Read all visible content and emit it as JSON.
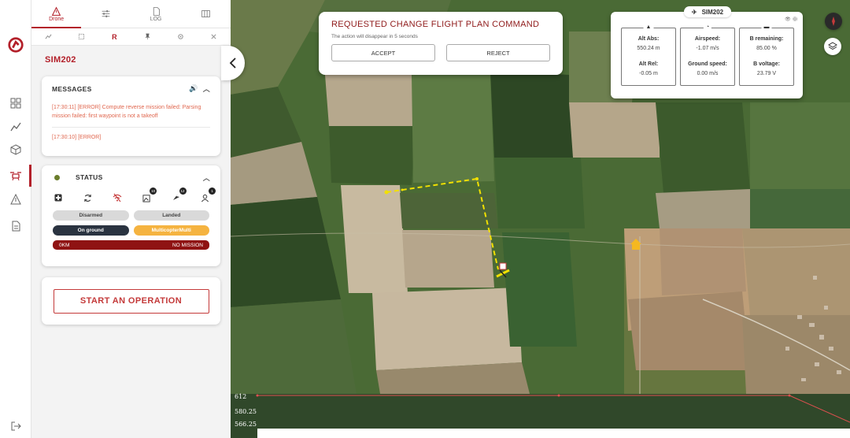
{
  "rail": {
    "items": [
      "dashboard-icon",
      "chart-icon",
      "cube-icon",
      "drone-icon",
      "alert-icon",
      "document-icon"
    ],
    "logout_icon": "logout-icon"
  },
  "tabs": [
    {
      "label": "Drone",
      "icon": "warning-triangle-icon",
      "active": true
    },
    {
      "label": "",
      "icon": "sliders-icon",
      "active": false
    },
    {
      "label": "LOG",
      "icon": "log-icon",
      "active": false
    },
    {
      "label": "",
      "icon": "map-grid-icon",
      "active": false
    }
  ],
  "subtabs": [
    "trend-icon",
    "crop-icon",
    "R",
    "pin-icon",
    "target-icon",
    "close-icon"
  ],
  "drone_name": "SIM202",
  "messages": {
    "title": "MESSAGES",
    "items": [
      "[17:30:11] [ERROR] Compute reverse mission failed: Parsing mission failed: first waypoint is not a takeoff",
      "[17:30:10] [ERROR]"
    ]
  },
  "status": {
    "title": "STATUS",
    "badges": {
      "photos": "10",
      "waypoints": "12",
      "users": "1"
    },
    "pills": [
      "Disarmed",
      "Landed",
      "On ground",
      "MulticopterMulti"
    ],
    "mission_left": "0KM",
    "mission_right": "NO MISSION"
  },
  "operation_button": "START AN OPERATION",
  "command": {
    "title": "REQUESTED CHANGE FLIGHT PLAN COMMAND",
    "subtitle": "The action will disappear in 5 seconds",
    "accept": "ACCEPT",
    "reject": "REJECT"
  },
  "telemetry": {
    "drone": "SIM202",
    "alt_abs_label": "Alt Abs:",
    "alt_abs": "550.24 m",
    "alt_rel_label": "Alt Rel:",
    "alt_rel": "-0.05 m",
    "airspeed_label": "Airspeed:",
    "airspeed": "-1.07 m/s",
    "ground_speed_label": "Ground speed:",
    "ground_speed": "0.00 m/s",
    "b_remaining_label": "B remaining:",
    "b_remaining": "85.00 %",
    "b_voltage_label": "B voltage:",
    "b_voltage": "23.79 V"
  },
  "altitude_strip": {
    "ticks": [
      "612",
      "580.25",
      "566.25"
    ]
  },
  "colors": {
    "brand": "#b3202a",
    "flight_path": "#f2e000",
    "mission_bar": "#8f1313",
    "pill_orange": "#f5b340"
  }
}
